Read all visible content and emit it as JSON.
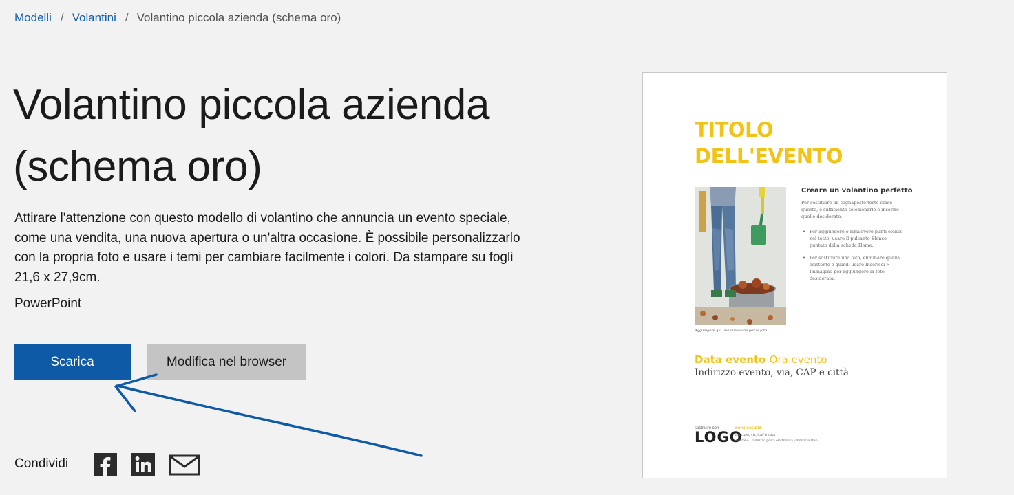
{
  "breadcrumb": {
    "items": [
      "Modelli",
      "Volantini"
    ],
    "separator": "/",
    "current": "Volantino piccola azienda (schema oro)"
  },
  "title": "Volantino piccola azienda (schema oro)",
  "description": "Attirare l'attenzione con questo modello di volantino che annuncia un evento speciale, come una vendita, una nuova apertura o un'altra occasione. È possibile personalizzarlo con la propria foto e usare i temi per cambiare facilmente i colori. Da stampare su fogli 21,6 x 27,9cm.",
  "app": "PowerPoint",
  "buttons": {
    "download": "Scarica",
    "edit_in_browser": "Modifica nel browser"
  },
  "share": {
    "label": "Condividi",
    "icons": [
      "facebook-icon",
      "linkedin-icon",
      "email-icon"
    ]
  },
  "annotation": {
    "type": "hand-drawn arrow pointing at download button",
    "color": "#0e5aa6"
  },
  "preview": {
    "title": "TITOLO DELL'EVENTO",
    "heading": "Creare un volantino perfetto",
    "body": "Per sostituire un segnaposto testo come questo, è sufficiente selezionarlo e inserire quello desiderato.",
    "bullets": [
      "Per aggiungere o rimuovere punti elenco nel testo, usare il pulsante Elenco puntato della scheda Home.",
      "Per sostituire una foto, eliminare quella esistente e quindi usare Inserisci > Immagine per aggiungere la foto desiderata."
    ],
    "caption": "Aggiungere qui una didascalia per la foto.",
    "date": "Data evento",
    "time": "Ora evento",
    "address": "Indirizzo evento, via, CAP e città",
    "logo_small": "sostituire con",
    "logo": "LOGO",
    "company": "NOME SOCIETÀ",
    "contact_line1": "Indirizzo, via, CAP e città",
    "contact_line2": "Telefono | Indirizzo posta elettronica | Indirizzo Web",
    "accent_color": "#f2c316"
  },
  "colors": {
    "background": "#f2f2f2",
    "link": "#0f5fb0",
    "primary_button": "#0e5aa6",
    "secondary_button": "#c4c4c4"
  }
}
